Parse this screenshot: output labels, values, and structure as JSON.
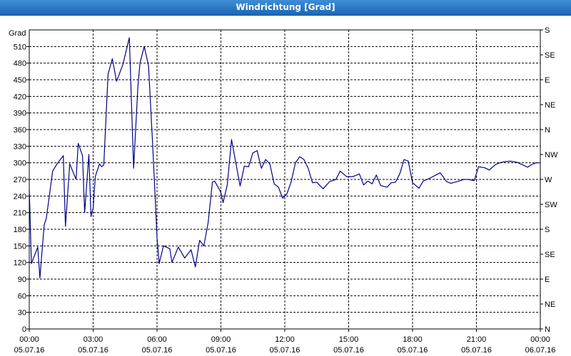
{
  "window": {
    "title": "Windrichtung [Grad]"
  },
  "chart_data": {
    "type": "line",
    "title": "Windrichtung [Grad]",
    "ylabel": "Grad",
    "ylim": [
      0,
      540
    ],
    "y_ticks": [
      0,
      30,
      60,
      90,
      120,
      150,
      180,
      210,
      240,
      270,
      300,
      330,
      360,
      390,
      420,
      450,
      480,
      510
    ],
    "right_axis_labels": [
      "N",
      "NE",
      "E",
      "SE",
      "S",
      "SW",
      "W",
      "NW",
      "N",
      "NE",
      "E",
      "SE",
      "S"
    ],
    "right_axis_values": [
      0,
      45,
      90,
      135,
      180,
      225,
      270,
      315,
      360,
      405,
      450,
      495,
      540
    ],
    "x_range_hours": [
      0,
      24
    ],
    "x_ticks": [
      {
        "hours": 0,
        "time": "00:00",
        "date": "05.07.16"
      },
      {
        "hours": 3,
        "time": "03:00",
        "date": "05.07.16"
      },
      {
        "hours": 6,
        "time": "06:00",
        "date": "05.07.16"
      },
      {
        "hours": 9,
        "time": "09:00",
        "date": "05.07.16"
      },
      {
        "hours": 12,
        "time": "12:00",
        "date": "05.07.16"
      },
      {
        "hours": 15,
        "time": "15:00",
        "date": "05.07.16"
      },
      {
        "hours": 18,
        "time": "18:00",
        "date": "05.07.16"
      },
      {
        "hours": 21,
        "time": "21:00",
        "date": "05.07.16"
      },
      {
        "hours": 24,
        "time": "00:00",
        "date": "06.07.16"
      }
    ],
    "grid": true,
    "series": [
      {
        "color": "#00008b",
        "x": [
          0.0,
          0.1,
          0.4,
          0.5,
          0.7,
          0.8,
          1.1,
          1.3,
          1.6,
          1.7,
          1.9,
          2.2,
          2.3,
          2.5,
          2.6,
          2.8,
          2.9,
          3.0,
          3.1,
          3.3,
          3.4,
          3.5,
          3.7,
          3.9,
          4.1,
          4.4,
          4.7,
          4.9,
          5.1,
          5.2,
          5.4,
          5.6,
          5.8,
          6.0,
          6.1,
          6.3,
          6.6,
          6.7,
          7.0,
          7.3,
          7.6,
          7.8,
          8.0,
          8.2,
          8.4,
          8.6,
          8.7,
          8.9,
          9.0,
          9.1,
          9.3,
          9.5,
          9.7,
          9.9,
          10.1,
          10.3,
          10.5,
          10.7,
          10.9,
          11.1,
          11.3,
          11.5,
          11.7,
          11.9,
          12.1,
          12.3,
          12.5,
          12.7,
          12.9,
          13.1,
          13.3,
          13.5,
          13.8,
          14.1,
          14.4,
          14.6,
          14.9,
          15.2,
          15.5,
          15.7,
          15.9,
          16.1,
          16.3,
          16.5,
          16.8,
          17.0,
          17.2,
          17.4,
          17.6,
          17.8,
          18.0,
          18.3,
          18.5,
          18.8,
          19.0,
          19.3,
          19.6,
          19.8,
          20.1,
          20.4,
          20.6,
          20.9,
          21.1,
          21.4,
          21.6,
          21.9,
          22.1,
          22.3,
          22.6,
          22.9,
          23.2,
          23.4,
          23.6,
          23.8,
          24.0
        ],
        "y": [
          252,
          118,
          148,
          92,
          188,
          200,
          285,
          298,
          313,
          185,
          298,
          270,
          335,
          313,
          210,
          315,
          203,
          218,
          275,
          298,
          293,
          296,
          460,
          488,
          447,
          478,
          526,
          290,
          438,
          480,
          510,
          475,
          330,
          165,
          118,
          150,
          145,
          120,
          148,
          128,
          143,
          112,
          160,
          150,
          192,
          265,
          267,
          254,
          246,
          228,
          260,
          342,
          300,
          258,
          294,
          293,
          318,
          322,
          290,
          306,
          298,
          262,
          256,
          236,
          244,
          266,
          300,
          311,
          306,
          290,
          264,
          265,
          253,
          266,
          270,
          285,
          275,
          275,
          280,
          260,
          267,
          262,
          278,
          259,
          256,
          264,
          265,
          280,
          306,
          303,
          264,
          254,
          267,
          272,
          276,
          282,
          266,
          263,
          266,
          270,
          270,
          268,
          293,
          291,
          287,
          297,
          300,
          302,
          303,
          301,
          296,
          292,
          297,
          300,
          300
        ]
      }
    ]
  }
}
